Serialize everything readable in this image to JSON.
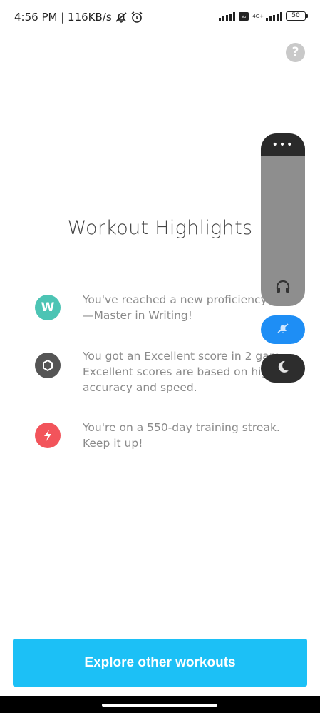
{
  "status_bar": {
    "time_speed": "4:56 PM | 116KB/s",
    "network_label": "4G+",
    "volte_label": "Vo LTE",
    "battery": "50"
  },
  "help": {
    "label": "?"
  },
  "title": "Workout Highlights",
  "highlights": [
    {
      "badge": "W",
      "color": "#4cc4b4",
      "text": "You've reached a new proficiency\n—Master in Writing!"
    },
    {
      "badge": "",
      "color": "#555555",
      "text": "You got an Excellent score in 2 gam\nExcellent scores are based on high\naccuracy and speed."
    },
    {
      "badge": "",
      "color": "#f2545b",
      "text": "You're on a 550-day training streak.\nKeep it up!"
    }
  ],
  "overlay": {
    "menu_label": "•••"
  },
  "cta": {
    "label": "Explore other workouts"
  }
}
